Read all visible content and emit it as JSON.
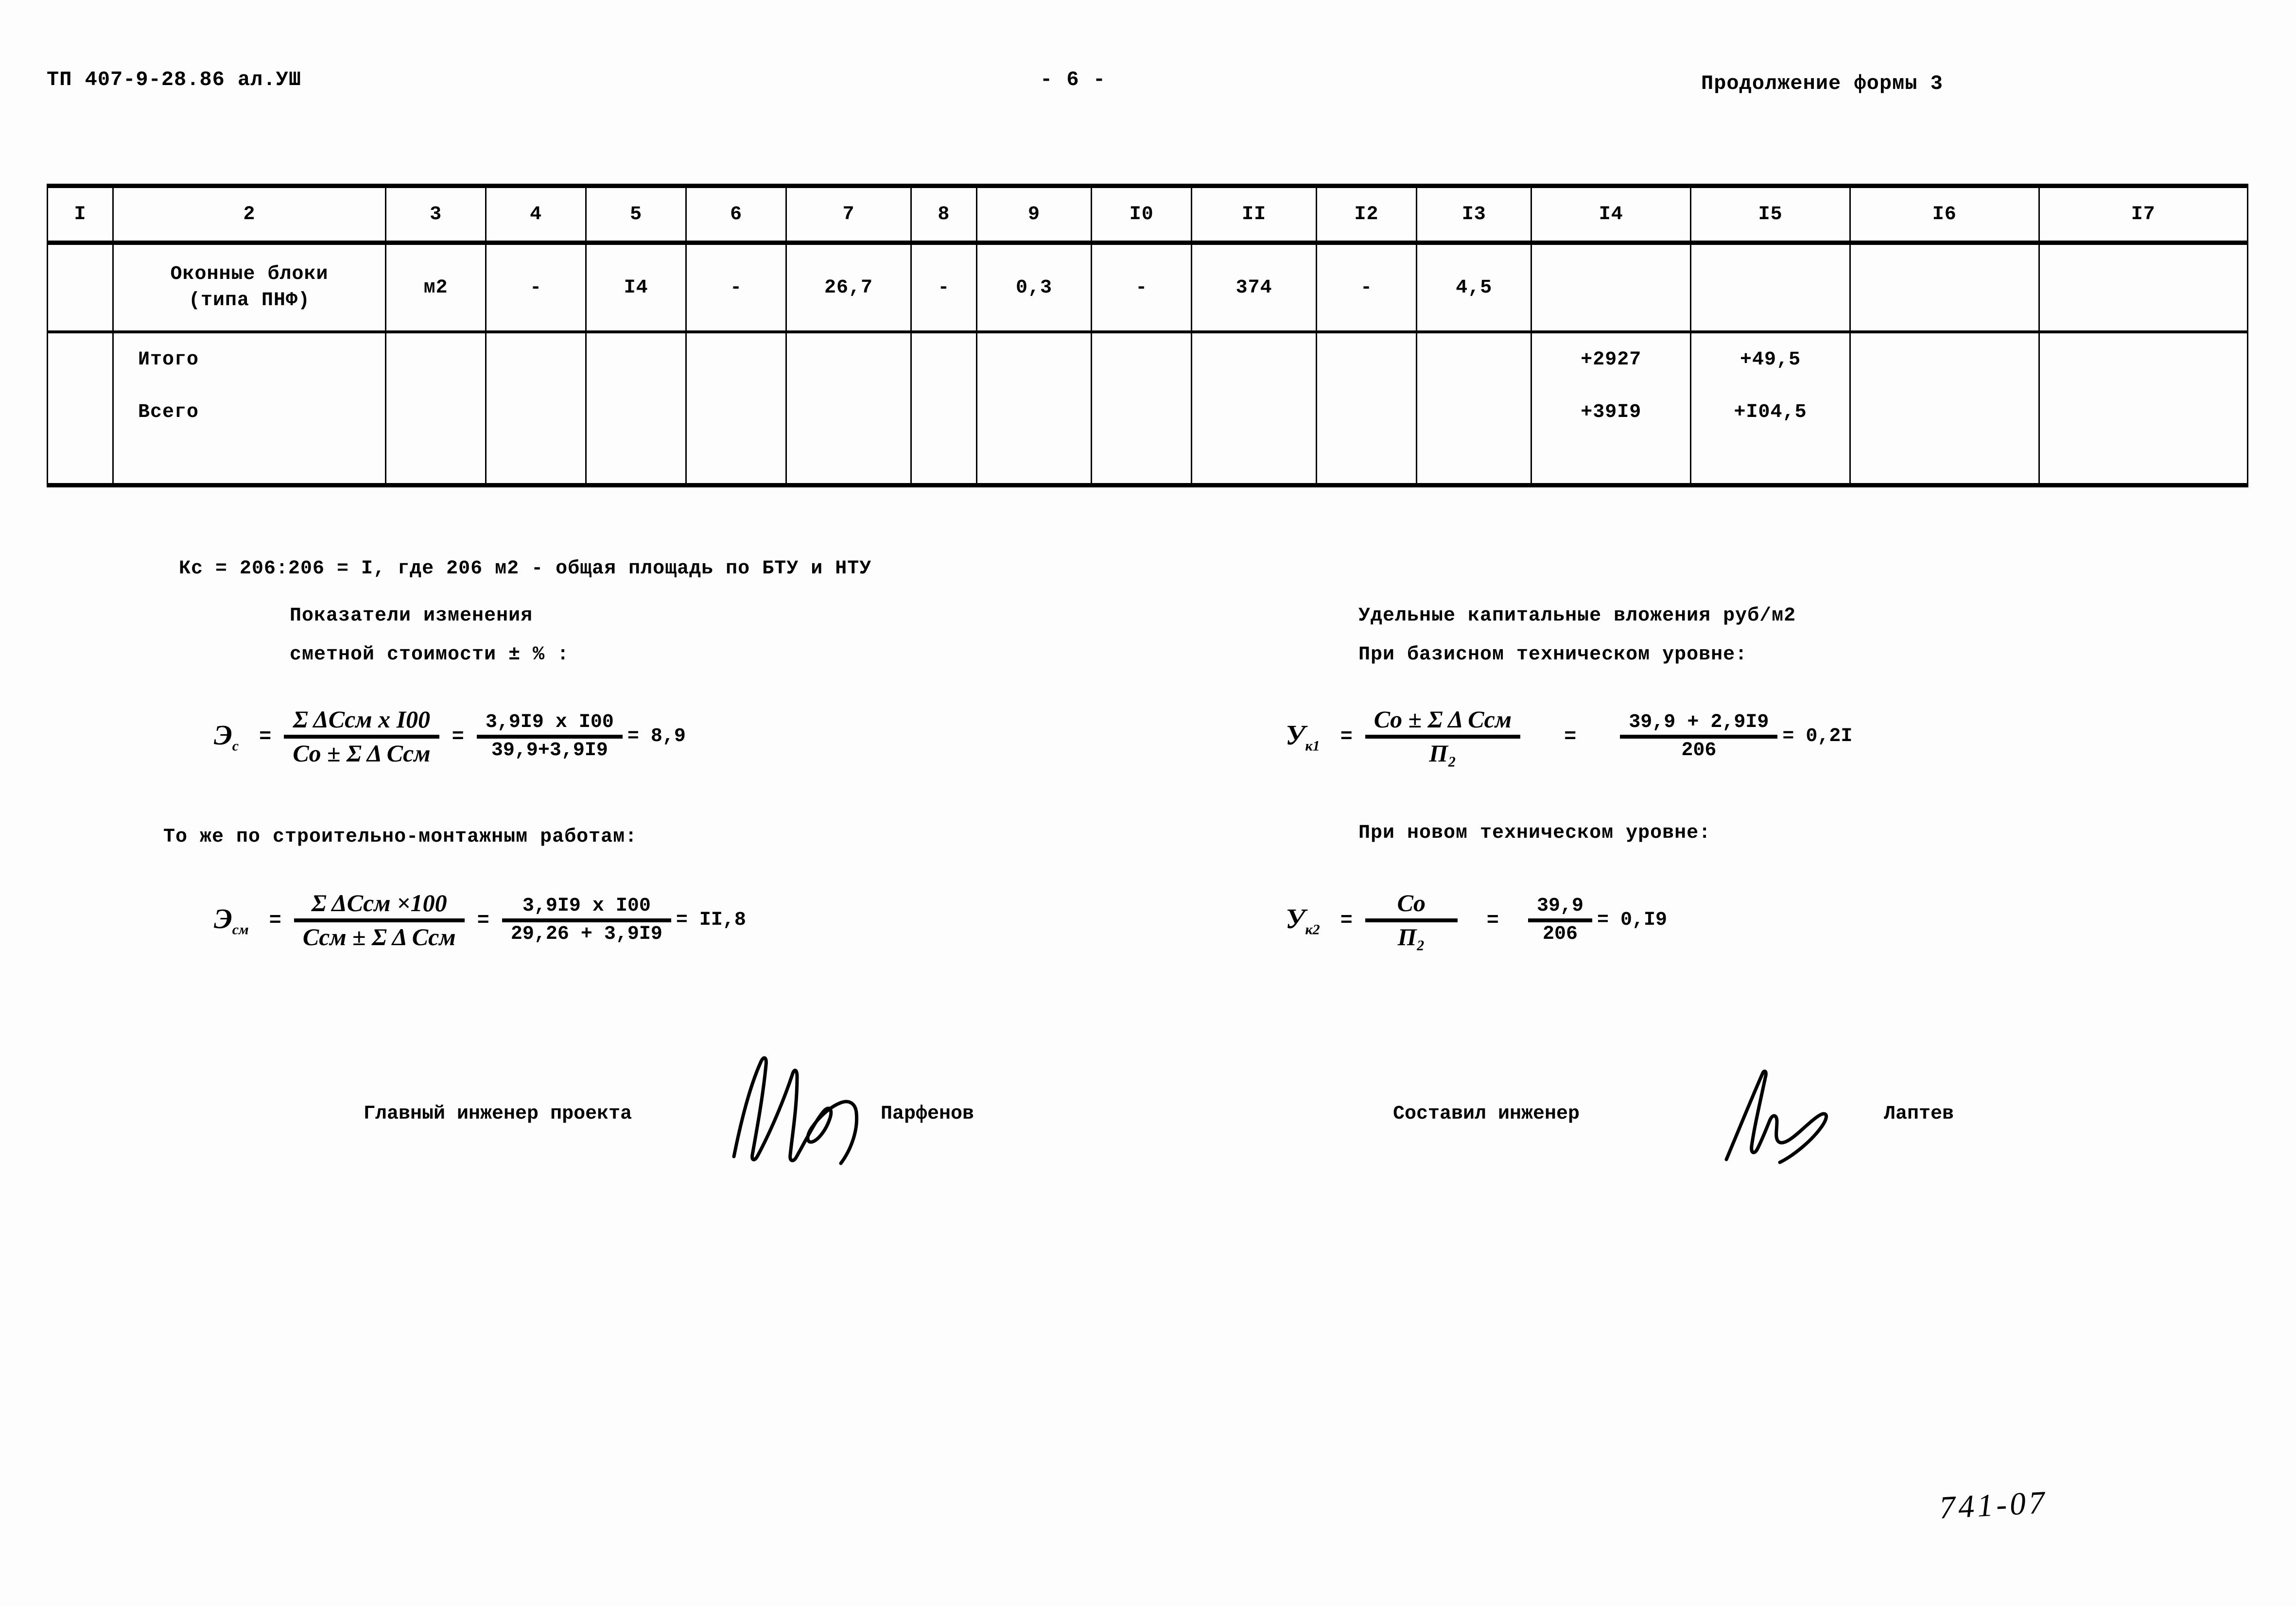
{
  "header": {
    "doc_code": "ТП 407-9-28.86 ал.УШ",
    "page_no": "- 6 -",
    "form_continuation": "Продолжение формы 3"
  },
  "table": {
    "column_numbers": [
      "I",
      "2",
      "3",
      "4",
      "5",
      "6",
      "7",
      "8",
      "9",
      "I0",
      "II",
      "I2",
      "I3",
      "I4",
      "I5",
      "I6",
      "I7"
    ],
    "rows": [
      {
        "name_line1": "Оконные блоки",
        "name_line2": "(типа ПНФ)",
        "c3": "м2",
        "c4": "-",
        "c5": "I4",
        "c6": "-",
        "c7": "26,7",
        "c8": "-",
        "c9": "0,3",
        "c10": "-",
        "c11": "374",
        "c12": "-",
        "c13": "4,5",
        "c14": "",
        "c15": "",
        "c16": "",
        "c17": ""
      }
    ],
    "totals": [
      {
        "label": "Итого",
        "c14": "+2927",
        "c15": "+49,5"
      },
      {
        "label": "Всего",
        "c14": "+39I9",
        "c15": "+I04,5"
      }
    ]
  },
  "notes": {
    "kc_line": "Кс = 206:206 = I, где 206 м2 - общая площадь по БТУ и НТУ"
  },
  "left_block": {
    "heading_line1": "Показатели изменения",
    "heading_line2": "сметной стоимости ± % :",
    "formula1": {
      "symbol": "Э",
      "symbol_sub": "с",
      "num": "Σ ΔCсм  x I00",
      "den": "Cо ± Σ Δ Cсм",
      "num2": "3,9I9 x I00",
      "den2": "39,9+3,9I9",
      "result": "= 8,9"
    },
    "subheading": "То же по строительно-монтажным работам:",
    "formula2": {
      "symbol": "Э",
      "symbol_sub": "см",
      "num": "Σ ΔCсм ×100",
      "den": "Cсм ± Σ Δ Cсм",
      "num2": "3,9I9 x I00",
      "den2": "29,26 + 3,9I9",
      "result": "= II,8"
    }
  },
  "right_block": {
    "heading_line1": "Удельные капитальные вложения руб/м2",
    "heading_line2": "При базисном техническом уровне:",
    "formula1": {
      "symbol": "У",
      "symbol_sub": "к1",
      "num": "Cо ± Σ Δ Cсм",
      "den": "П₂",
      "num2": "39,9 + 2,9I9",
      "den2": "206",
      "result": "= 0,2I"
    },
    "subheading": "При новом техническом уровне:",
    "formula2": {
      "symbol": "У",
      "symbol_sub": "к2",
      "num": "Cо",
      "den": "П₂",
      "num2": "39,9",
      "den2": "206",
      "result": "= 0,I9"
    }
  },
  "signatures": {
    "left_role": "Главный инженер проекта",
    "left_name": "Парфенов",
    "right_role": "Составил инженер",
    "right_name": "Лаптев"
  },
  "footer": {
    "handwritten_code": "741-07"
  }
}
